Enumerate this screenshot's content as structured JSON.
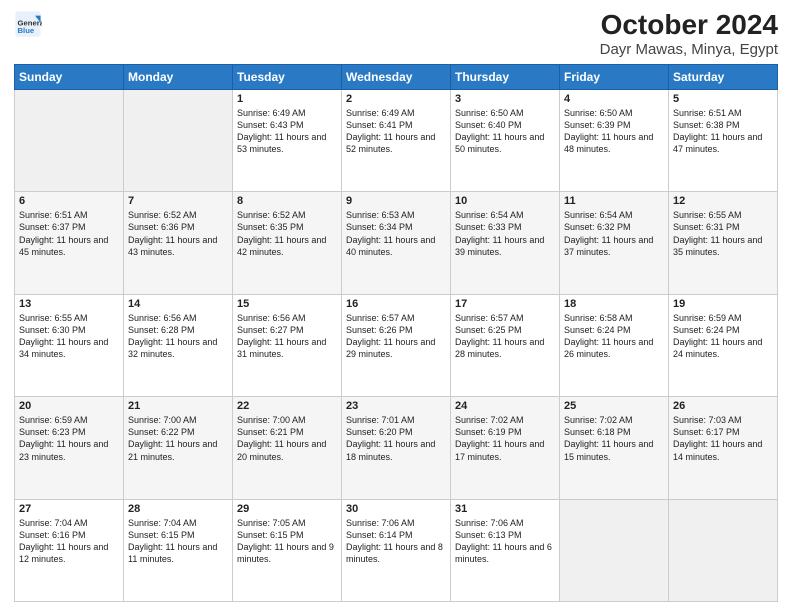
{
  "header": {
    "logo": {
      "line1": "General",
      "line2": "Blue"
    },
    "title": "October 2024",
    "subtitle": "Dayr Mawas, Minya, Egypt"
  },
  "days_of_week": [
    "Sunday",
    "Monday",
    "Tuesday",
    "Wednesday",
    "Thursday",
    "Friday",
    "Saturday"
  ],
  "weeks": [
    [
      {
        "day": "",
        "empty": true
      },
      {
        "day": "",
        "empty": true
      },
      {
        "day": "1",
        "sunrise": "6:49 AM",
        "sunset": "6:43 PM",
        "daylight": "11 hours and 53 minutes."
      },
      {
        "day": "2",
        "sunrise": "6:49 AM",
        "sunset": "6:41 PM",
        "daylight": "11 hours and 52 minutes."
      },
      {
        "day": "3",
        "sunrise": "6:50 AM",
        "sunset": "6:40 PM",
        "daylight": "11 hours and 50 minutes."
      },
      {
        "day": "4",
        "sunrise": "6:50 AM",
        "sunset": "6:39 PM",
        "daylight": "11 hours and 48 minutes."
      },
      {
        "day": "5",
        "sunrise": "6:51 AM",
        "sunset": "6:38 PM",
        "daylight": "11 hours and 47 minutes."
      }
    ],
    [
      {
        "day": "6",
        "sunrise": "6:51 AM",
        "sunset": "6:37 PM",
        "daylight": "11 hours and 45 minutes."
      },
      {
        "day": "7",
        "sunrise": "6:52 AM",
        "sunset": "6:36 PM",
        "daylight": "11 hours and 43 minutes."
      },
      {
        "day": "8",
        "sunrise": "6:52 AM",
        "sunset": "6:35 PM",
        "daylight": "11 hours and 42 minutes."
      },
      {
        "day": "9",
        "sunrise": "6:53 AM",
        "sunset": "6:34 PM",
        "daylight": "11 hours and 40 minutes."
      },
      {
        "day": "10",
        "sunrise": "6:54 AM",
        "sunset": "6:33 PM",
        "daylight": "11 hours and 39 minutes."
      },
      {
        "day": "11",
        "sunrise": "6:54 AM",
        "sunset": "6:32 PM",
        "daylight": "11 hours and 37 minutes."
      },
      {
        "day": "12",
        "sunrise": "6:55 AM",
        "sunset": "6:31 PM",
        "daylight": "11 hours and 35 minutes."
      }
    ],
    [
      {
        "day": "13",
        "sunrise": "6:55 AM",
        "sunset": "6:30 PM",
        "daylight": "11 hours and 34 minutes."
      },
      {
        "day": "14",
        "sunrise": "6:56 AM",
        "sunset": "6:28 PM",
        "daylight": "11 hours and 32 minutes."
      },
      {
        "day": "15",
        "sunrise": "6:56 AM",
        "sunset": "6:27 PM",
        "daylight": "11 hours and 31 minutes."
      },
      {
        "day": "16",
        "sunrise": "6:57 AM",
        "sunset": "6:26 PM",
        "daylight": "11 hours and 29 minutes."
      },
      {
        "day": "17",
        "sunrise": "6:57 AM",
        "sunset": "6:25 PM",
        "daylight": "11 hours and 28 minutes."
      },
      {
        "day": "18",
        "sunrise": "6:58 AM",
        "sunset": "6:24 PM",
        "daylight": "11 hours and 26 minutes."
      },
      {
        "day": "19",
        "sunrise": "6:59 AM",
        "sunset": "6:24 PM",
        "daylight": "11 hours and 24 minutes."
      }
    ],
    [
      {
        "day": "20",
        "sunrise": "6:59 AM",
        "sunset": "6:23 PM",
        "daylight": "11 hours and 23 minutes."
      },
      {
        "day": "21",
        "sunrise": "7:00 AM",
        "sunset": "6:22 PM",
        "daylight": "11 hours and 21 minutes."
      },
      {
        "day": "22",
        "sunrise": "7:00 AM",
        "sunset": "6:21 PM",
        "daylight": "11 hours and 20 minutes."
      },
      {
        "day": "23",
        "sunrise": "7:01 AM",
        "sunset": "6:20 PM",
        "daylight": "11 hours and 18 minutes."
      },
      {
        "day": "24",
        "sunrise": "7:02 AM",
        "sunset": "6:19 PM",
        "daylight": "11 hours and 17 minutes."
      },
      {
        "day": "25",
        "sunrise": "7:02 AM",
        "sunset": "6:18 PM",
        "daylight": "11 hours and 15 minutes."
      },
      {
        "day": "26",
        "sunrise": "7:03 AM",
        "sunset": "6:17 PM",
        "daylight": "11 hours and 14 minutes."
      }
    ],
    [
      {
        "day": "27",
        "sunrise": "7:04 AM",
        "sunset": "6:16 PM",
        "daylight": "11 hours and 12 minutes."
      },
      {
        "day": "28",
        "sunrise": "7:04 AM",
        "sunset": "6:15 PM",
        "daylight": "11 hours and 11 minutes."
      },
      {
        "day": "29",
        "sunrise": "7:05 AM",
        "sunset": "6:15 PM",
        "daylight": "11 hours and 9 minutes."
      },
      {
        "day": "30",
        "sunrise": "7:06 AM",
        "sunset": "6:14 PM",
        "daylight": "11 hours and 8 minutes."
      },
      {
        "day": "31",
        "sunrise": "7:06 AM",
        "sunset": "6:13 PM",
        "daylight": "11 hours and 6 minutes."
      },
      {
        "day": "",
        "empty": true
      },
      {
        "day": "",
        "empty": true
      }
    ]
  ],
  "labels": {
    "sunrise": "Sunrise:",
    "sunset": "Sunset:",
    "daylight": "Daylight:"
  }
}
